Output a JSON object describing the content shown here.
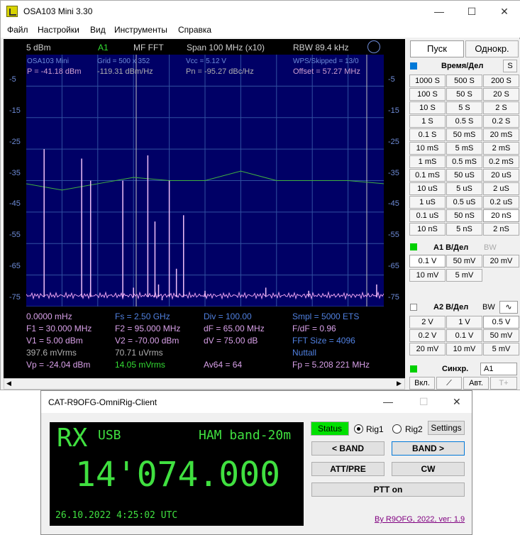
{
  "window": {
    "title": "OSA103 Mini 3.30",
    "minimize": "—",
    "maximize": "☐",
    "close": "✕"
  },
  "menu": [
    "Файл",
    "Настройки",
    "Вид",
    "Инструменты",
    "Справка"
  ],
  "scope_header": {
    "ref": "5 dBm",
    "channel": "A1",
    "mode": "MF FFT",
    "span": "Span 100 MHz (x10)",
    "rbw": "RBW 89.4 kHz"
  },
  "scope_overlay": {
    "device": "OSA103 Mini",
    "grid": "Grid = 500 x 352",
    "vcc": "Vcc = 5.12 V",
    "wps": "WPS/Skipped = 13/0",
    "p": "P = -41.18 dBm",
    "dbmhz": "-119.31 dBm/Hz",
    "pn": "Pn = -95.27 dBc/Hz",
    "offset": "Offset = 57.27 MHz"
  },
  "y_labels": [
    "-5",
    "-15",
    "-25",
    "-35",
    "-45",
    "-55",
    "-65",
    "-75"
  ],
  "measurements": {
    "r1": [
      "0.0000 mHz",
      "Fs = 2.50 GHz",
      "Div = 100.00",
      "Smpl = 5000 ETS"
    ],
    "r2": [
      "F1 = 30.000 MHz",
      "F2 = 95.000 MHz",
      "dF = 65.00 MHz",
      "F/dF = 0.96"
    ],
    "r3": [
      "V1 = 5.00 dBm",
      "V2 = -70.00 dBm",
      "dV = 75.00 dB",
      "FFT Size = 4096"
    ],
    "r4": [
      "397.6 mVrms",
      "70.71 uVrms",
      "",
      "Nuttall"
    ],
    "r5": [
      "Vp = -24.04 dBm",
      "14.05 mVrms",
      "Av64 = 64",
      "Fp = 5.208 221 MHz"
    ]
  },
  "chart_data": {
    "type": "line",
    "title": "",
    "xlabel": "",
    "ylabel": "",
    "ylim": [
      -75,
      5
    ],
    "grid": true,
    "peaks_x": [
      0.05,
      0.155,
      0.18,
      0.27,
      0.3,
      0.34,
      0.36,
      0.37,
      0.38,
      0.4,
      0.42,
      0.44,
      0.5,
      0.56,
      0.67,
      0.79,
      0.9,
      0.98
    ],
    "peaks_y": [
      -25,
      -28,
      -35,
      -35,
      -69,
      -27,
      -48,
      -68,
      -73,
      -35,
      -63,
      -46,
      -70,
      -72,
      -69,
      -70,
      -72,
      -68
    ],
    "green_trace": [
      [
        0,
        -36
      ],
      [
        0.1,
        -38
      ],
      [
        0.2,
        -36
      ],
      [
        0.3,
        -34
      ],
      [
        0.4,
        -35
      ],
      [
        0.5,
        -35
      ],
      [
        0.6,
        -32
      ],
      [
        0.7,
        -35
      ],
      [
        0.8,
        -35
      ],
      [
        0.9,
        -35
      ],
      [
        1,
        -36
      ]
    ]
  },
  "panel": {
    "start": "Пуск",
    "single": "Однокр.",
    "time_div": "Время/Дел",
    "s_label": "S",
    "time_buttons": [
      "1000 S",
      "500 S",
      "200 S",
      "100 S",
      "50 S",
      "20 S",
      "10 S",
      "5 S",
      "2 S",
      "1 S",
      "0.5 S",
      "0.2 S",
      "0.1 S",
      "50 mS",
      "20 mS",
      "10 mS",
      "5 mS",
      "2 mS",
      "1 mS",
      "0.5 mS",
      "0.2 mS",
      "0.1 mS",
      "50 uS",
      "20 uS",
      "10 uS",
      "5 uS",
      "2 uS",
      "1 uS",
      "0.5 uS",
      "0.2 uS",
      "0.1 uS",
      "50 nS",
      "20 nS",
      "10 nS",
      "5 nS",
      "2 nS"
    ],
    "a1": "A1 В/Дел",
    "bw": "BW",
    "a1_buttons": [
      "0.1 V",
      "50 mV",
      "20 mV",
      "10 mV",
      "5 mV"
    ],
    "a2": "A2 В/Дел",
    "a2_buttons": [
      "2 V",
      "1 V",
      "0.5 V",
      "0.2 V",
      "0.1 V",
      "50 mV",
      "20 mV",
      "10 mV",
      "5 mV"
    ],
    "sync": "Синхр.",
    "sync_sel": "A1",
    "on": "Вкл.",
    "auto": "Авт.",
    "tplus": "T+",
    "accent": "#00d000"
  },
  "client": {
    "title": "CAT-R9OFG-OmniRig-Client",
    "minimize": "—",
    "maximize": "☐",
    "close": "✕",
    "rx": "RX",
    "mode": "USB",
    "band": "HAM band-20m",
    "freq": "14'074.000",
    "datetime": "26.10.2022 4:25:02 UTC",
    "status": "Status",
    "rig1": "Rig1",
    "rig2": "Rig2",
    "settings": "Settings",
    "band_prev": "< BAND",
    "band_next": "BAND >",
    "attpre": "ATT/PRE",
    "cw": "CW",
    "ptt": "PTT on",
    "credit": "By R9OFG, 2022, ver: 1.9"
  }
}
